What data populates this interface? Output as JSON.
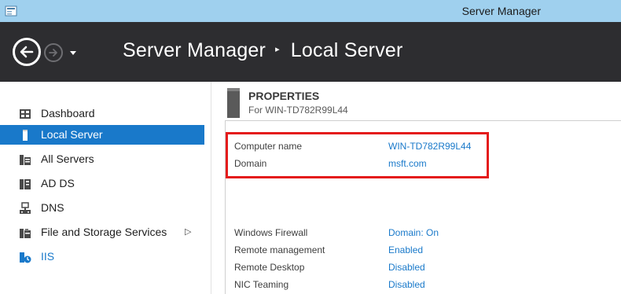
{
  "window": {
    "title": "Server Manager"
  },
  "header": {
    "app_name": "Server Manager",
    "page_name": "Local Server",
    "separator": "▸"
  },
  "sidebar": {
    "items": [
      {
        "label": "Dashboard",
        "icon": "dashboard-icon",
        "active": false
      },
      {
        "label": "Local Server",
        "icon": "server-icon",
        "active": true
      },
      {
        "label": "All Servers",
        "icon": "all-servers-icon",
        "active": false
      },
      {
        "label": "AD DS",
        "icon": "ad-ds-icon",
        "active": false
      },
      {
        "label": "DNS",
        "icon": "dns-icon",
        "active": false
      },
      {
        "label": "File and Storage Services",
        "icon": "file-storage-icon",
        "active": false,
        "has_submenu": true,
        "arrow": "▷"
      },
      {
        "label": "IIS",
        "icon": "iis-icon",
        "active": false
      }
    ]
  },
  "properties": {
    "title": "PROPERTIES",
    "subtitle": "For WIN-TD782R99L44",
    "identity": [
      {
        "label": "Computer name",
        "value": "WIN-TD782R99L44"
      },
      {
        "label": "Domain",
        "value": "msft.com"
      }
    ],
    "settings": [
      {
        "label": "Windows Firewall",
        "value": "Domain: On"
      },
      {
        "label": "Remote management",
        "value": "Enabled"
      },
      {
        "label": "Remote Desktop",
        "value": "Disabled"
      },
      {
        "label": "NIC Teaming",
        "value": "Disabled"
      }
    ]
  },
  "colors": {
    "titlebar": "#9fd0ee",
    "header": "#2d2d30",
    "accent": "#1979ca",
    "highlight_border": "#e41c1c"
  }
}
